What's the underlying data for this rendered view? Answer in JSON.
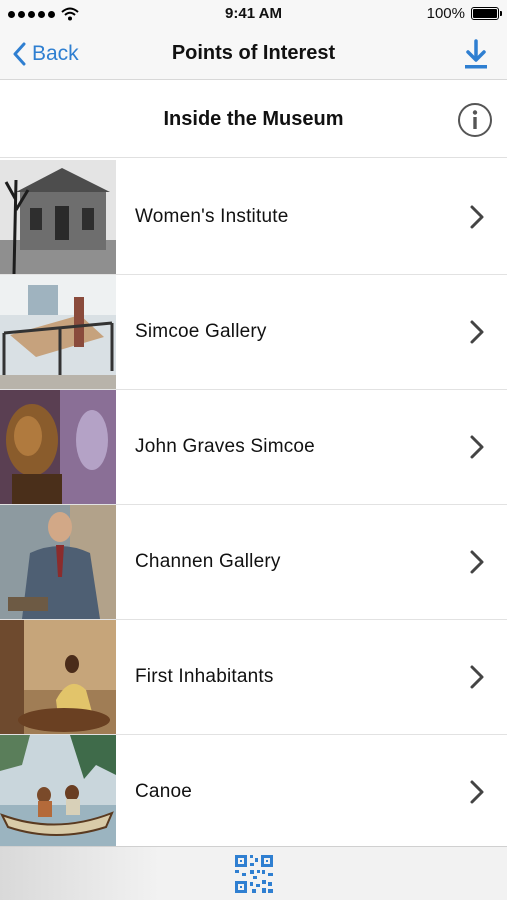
{
  "status_bar": {
    "time": "9:41 AM",
    "battery": "100%"
  },
  "nav": {
    "back_label": "Back",
    "title": "Points of Interest"
  },
  "section": {
    "title": "Inside the Museum"
  },
  "items": [
    {
      "label": "Women's Institute"
    },
    {
      "label": "Simcoe Gallery"
    },
    {
      "label": "John Graves Simcoe"
    },
    {
      "label": "Channen Gallery"
    },
    {
      "label": "First Inhabitants"
    },
    {
      "label": "Canoe"
    }
  ],
  "icons": {
    "back": "chevron-left-icon",
    "download": "download-icon",
    "info": "info-icon",
    "row": "chevron-right-icon",
    "tab": "qr-code-icon"
  },
  "colors": {
    "accent": "#2f7fd1",
    "chevron": "#444444",
    "bar_background": "#f7f7f7"
  }
}
